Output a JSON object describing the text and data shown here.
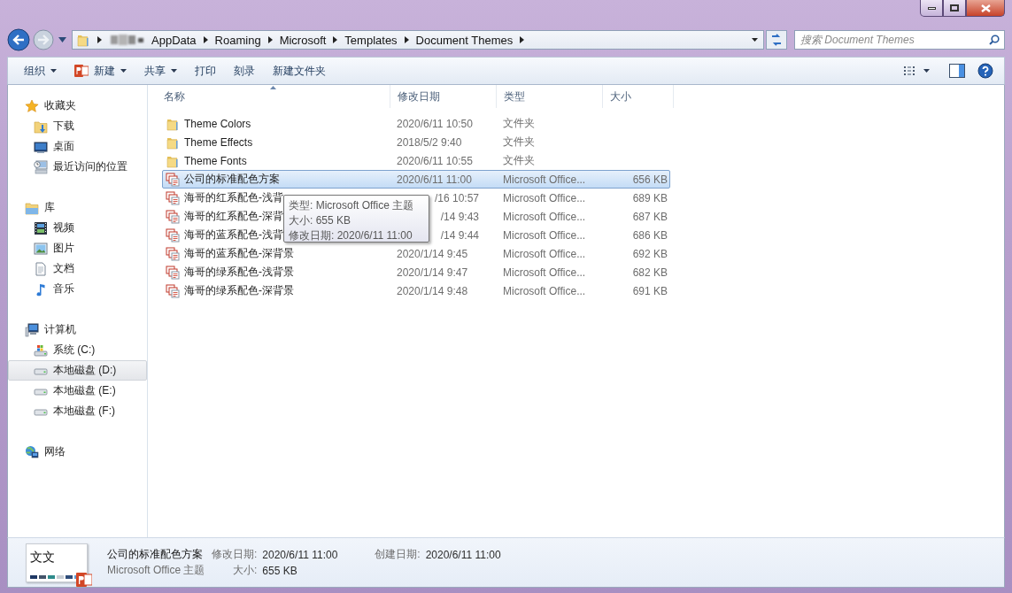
{
  "address_bar": {
    "breadcrumbs": [
      "AppData",
      "Roaming",
      "Microsoft",
      "Templates",
      "Document Themes"
    ]
  },
  "search": {
    "placeholder": "搜索 Document Themes"
  },
  "toolbar": {
    "items": [
      {
        "label": "组织",
        "kind": "menu"
      },
      {
        "label": "新建",
        "kind": "new"
      },
      {
        "label": "共享",
        "kind": "menu"
      },
      {
        "label": "打印",
        "kind": "plain"
      },
      {
        "label": "刻录",
        "kind": "plain"
      },
      {
        "label": "新建文件夹",
        "kind": "plain"
      }
    ]
  },
  "sidebar": {
    "groups": [
      {
        "label": "收藏夹",
        "kind": "star",
        "children": [
          {
            "label": "下载",
            "kind": "download",
            "selected": false
          },
          {
            "label": "桌面",
            "kind": "desktop",
            "selected": false
          },
          {
            "label": "最近访问的位置",
            "kind": "recent",
            "selected": false
          }
        ]
      },
      {
        "label": "库",
        "kind": "library",
        "children": [
          {
            "label": "视频",
            "kind": "video",
            "selected": false
          },
          {
            "label": "图片",
            "kind": "picture",
            "selected": false
          },
          {
            "label": "文档",
            "kind": "document",
            "selected": false
          },
          {
            "label": "音乐",
            "kind": "music",
            "selected": false
          }
        ]
      },
      {
        "label": "计算机",
        "kind": "computer",
        "children": [
          {
            "label": "系统 (C:)",
            "kind": "system-drive",
            "selected": false
          },
          {
            "label": "本地磁盘 (D:)",
            "kind": "drive",
            "selected": true
          },
          {
            "label": "本地磁盘 (E:)",
            "kind": "drive",
            "selected": false
          },
          {
            "label": "本地磁盘 (F:)",
            "kind": "drive",
            "selected": false
          }
        ]
      },
      {
        "label": "网络",
        "kind": "network"
      }
    ]
  },
  "table": {
    "columns": [
      {
        "label": "名称",
        "sorted": true
      },
      {
        "label": "修改日期",
        "sorted": false
      },
      {
        "label": "类型",
        "sorted": false
      },
      {
        "label": "大小",
        "sorted": false
      }
    ],
    "rows": [
      {
        "kind": "folder",
        "name": "Theme Colors",
        "date": "2020/6/11 10:50",
        "type": "文件夹",
        "selected": false,
        "covered": false
      },
      {
        "kind": "folder",
        "name": "Theme Effects",
        "date": "2018/5/2 9:40",
        "type": "文件夹",
        "selected": false,
        "covered": false
      },
      {
        "kind": "folder",
        "name": "Theme Fonts",
        "date": "2020/6/11 10:55",
        "type": "文件夹",
        "selected": false,
        "covered": false
      },
      {
        "kind": "theme",
        "name": "公司的标准配色方案",
        "date": "2020/6/11 11:00",
        "type": "Microsoft Office...",
        "size": "656 KB",
        "selected": true,
        "covered": false
      },
      {
        "kind": "theme",
        "name": "海哥的红系配色-浅背",
        "date": "/16 10:57",
        "type": "Microsoft Office...",
        "size": "689 KB",
        "selected": false,
        "covered": true
      },
      {
        "kind": "theme",
        "name": "海哥的红系配色-深背",
        "date": "/14 9:43",
        "type": "Microsoft Office...",
        "size": "687 KB",
        "selected": false,
        "covered": true
      },
      {
        "kind": "theme",
        "name": "海哥的蓝系配色-浅背",
        "date": "/14 9:44",
        "type": "Microsoft Office...",
        "size": "686 KB",
        "selected": false,
        "covered": true
      },
      {
        "kind": "theme",
        "name": "海哥的蓝系配色-深背景",
        "date": "2020/1/14 9:45",
        "type": "Microsoft Office...",
        "size": "692 KB",
        "selected": false,
        "covered": false
      },
      {
        "kind": "theme",
        "name": "海哥的绿系配色-浅背景",
        "date": "2020/1/14 9:47",
        "type": "Microsoft Office...",
        "size": "682 KB",
        "selected": false,
        "covered": false
      },
      {
        "kind": "theme",
        "name": "海哥的绿系配色-深背景",
        "date": "2020/1/14 9:48",
        "type": "Microsoft Office...",
        "size": "691 KB",
        "selected": false,
        "covered": false
      }
    ]
  },
  "tooltip": {
    "lines": [
      "类型: Microsoft Office 主题",
      "大小: 655 KB",
      "修改日期: 2020/6/11 11:00"
    ]
  },
  "details": {
    "thumbnail_text": "文文",
    "name": "公司的标准配色方案",
    "type": "Microsoft Office 主题",
    "fields": [
      {
        "label": "修改日期:",
        "value": "2020/6/11 11:00"
      },
      {
        "label": "大小:",
        "value": "655 KB"
      },
      {
        "label": "创建日期:",
        "value": "2020/6/11 11:00"
      }
    ]
  }
}
